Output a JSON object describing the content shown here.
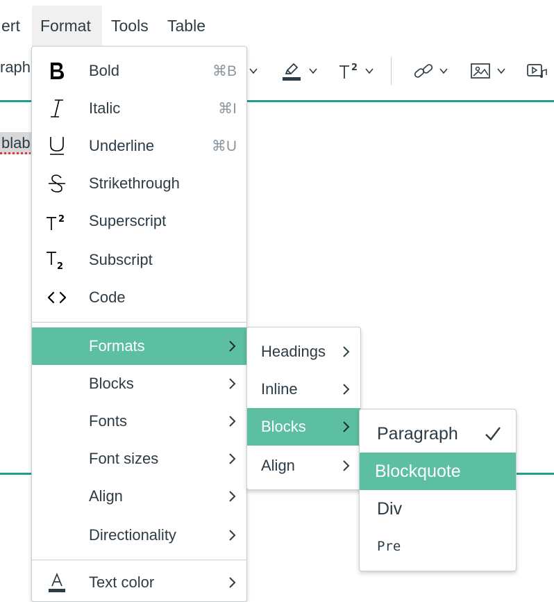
{
  "menubar": {
    "items": [
      {
        "label": "ert"
      },
      {
        "label": "Format"
      },
      {
        "label": "Tools"
      },
      {
        "label": "Table"
      }
    ]
  },
  "toolbar": {
    "block_format_partial": "raph"
  },
  "content": {
    "selected_text": "blab"
  },
  "format_menu": {
    "items": [
      {
        "label": "Bold",
        "shortcut": "⌘B",
        "icon": "bold-icon"
      },
      {
        "label": "Italic",
        "shortcut": "⌘I",
        "icon": "italic-icon"
      },
      {
        "label": "Underline",
        "shortcut": "⌘U",
        "icon": "underline-icon"
      },
      {
        "label": "Strikethrough",
        "icon": "strikethrough-icon"
      },
      {
        "label": "Superscript",
        "icon": "superscript-icon"
      },
      {
        "label": "Subscript",
        "icon": "subscript-icon"
      },
      {
        "label": "Code",
        "icon": "code-icon"
      }
    ],
    "submenus": [
      {
        "label": "Formats"
      },
      {
        "label": "Blocks"
      },
      {
        "label": "Fonts"
      },
      {
        "label": "Font sizes"
      },
      {
        "label": "Align"
      },
      {
        "label": "Directionality"
      }
    ],
    "text_color": {
      "label": "Text color",
      "icon": "text-color-icon"
    }
  },
  "formats_submenu": {
    "items": [
      {
        "label": "Headings"
      },
      {
        "label": "Inline"
      },
      {
        "label": "Blocks"
      },
      {
        "label": "Align"
      }
    ]
  },
  "blocks_submenu": {
    "items": [
      {
        "label": "Paragraph",
        "checked": true
      },
      {
        "label": "Blockquote"
      },
      {
        "label": "Div"
      },
      {
        "label": "Pre"
      }
    ]
  },
  "colors": {
    "accent": "#5cbfa1",
    "teal_rule": "#1fa18a",
    "text": "#2d3b45",
    "shortcut": "#8b969e"
  }
}
